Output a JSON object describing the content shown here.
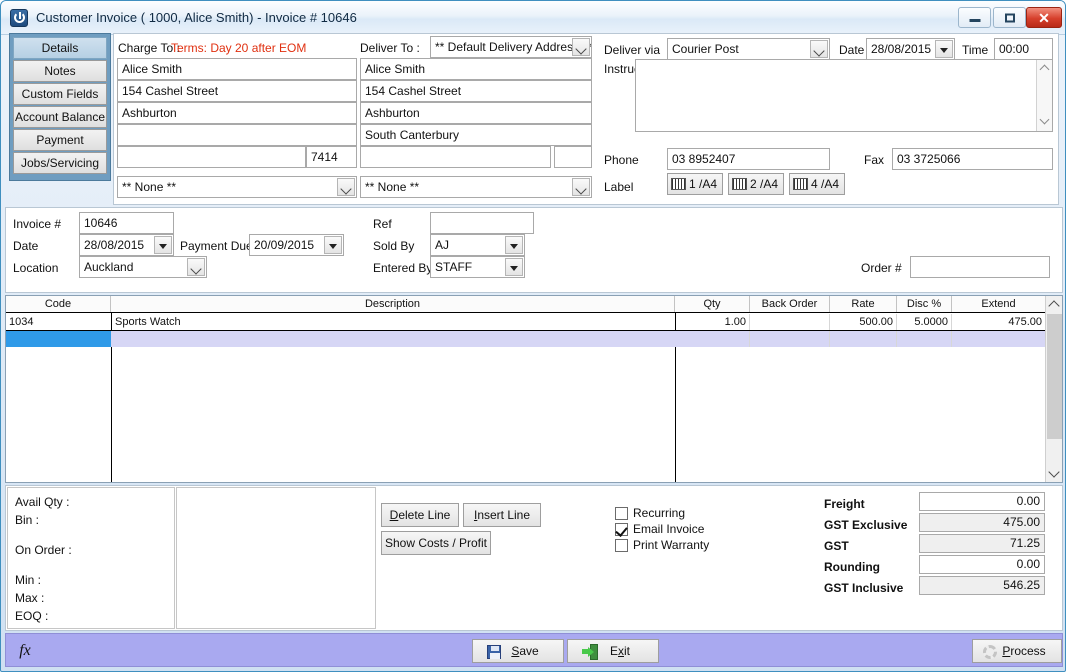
{
  "window": {
    "title": "Customer Invoice ( 1000, Alice Smith) - Invoice # 10646",
    "app_icon": "power-icon",
    "minimize_label": "",
    "maximize_label": "",
    "close_label": "✕"
  },
  "tabs": [
    {
      "label": "Details",
      "active": true
    },
    {
      "label": "Notes",
      "active": false
    },
    {
      "label": "Custom Fields",
      "active": false
    },
    {
      "label": "Account Balance",
      "active": false
    },
    {
      "label": "Payment",
      "active": false
    },
    {
      "label": "Jobs/Servicing",
      "active": false
    }
  ],
  "charge_to": {
    "label": "Charge To :",
    "terms": "Terms: Day 20 after EOM",
    "terms_color": "#e03010",
    "line1": "Alice Smith",
    "line2": "154 Cashel Street",
    "line3": "Ashburton",
    "line4": "",
    "line5": "",
    "postcode": "7414",
    "contact": "** None **"
  },
  "deliver_to": {
    "label": "Deliver To :",
    "address_select": "** Default Delivery Address **",
    "line1": "Alice Smith",
    "line2": "154 Cashel Street",
    "line3": "Ashburton",
    "line4": "South Canterbury",
    "line5": "",
    "postcode": "",
    "contact": "** None **"
  },
  "delivery": {
    "deliver_via_label": "Deliver via",
    "deliver_via": "Courier Post",
    "date_label": "Date",
    "date": "28/08/2015",
    "time_label": "Time",
    "time": "00:00",
    "instructions_label": "Instructions",
    "instructions": "",
    "phone_label": "Phone",
    "phone": "03 8952407",
    "fax_label": "Fax",
    "fax": "03 3725066",
    "label_label": "Label",
    "label_buttons": [
      "1 /A4",
      "2 /A4",
      "4 /A4"
    ]
  },
  "invoice": {
    "invoice_no_label": "Invoice #",
    "invoice_no": "10646",
    "date_label": "Date",
    "date": "28/08/2015",
    "payment_due_label": "Payment Due",
    "payment_due": "20/09/2015",
    "location_label": "Location",
    "location": "Auckland",
    "ref_label": "Ref",
    "ref": "",
    "sold_by_label": "Sold By",
    "sold_by": "AJ",
    "entered_by_label": "Entered By",
    "entered_by": "STAFF",
    "order_no_label": "Order #",
    "order_no": ""
  },
  "grid": {
    "columns": [
      "Code",
      "Description",
      "Qty",
      "Back Order",
      "Rate",
      "Disc %",
      "Extend"
    ],
    "rows": [
      {
        "code": "1034",
        "description": "Sports Watch",
        "qty": "1.00",
        "back_order": "",
        "rate": "500.00",
        "disc": "5.0000",
        "extend": "475.00"
      },
      {
        "code": "",
        "description": "",
        "qty": "",
        "back_order": "",
        "rate": "",
        "disc": "",
        "extend": "",
        "selected": true
      }
    ]
  },
  "stock_info": {
    "avail_qty_label": "Avail Qty :",
    "bin_label": "Bin :",
    "on_order_label": "On Order :",
    "min_label": "Min :",
    "max_label": "Max :",
    "eoq_label": "EOQ :"
  },
  "line_actions": {
    "delete_line": "Delete Line",
    "delete_line_accel": "D",
    "insert_line": "Insert Line",
    "insert_line_accel": "I",
    "show_costs": "Show Costs / Profit"
  },
  "options": [
    {
      "label": "Recurring",
      "checked": false
    },
    {
      "label": "Email Invoice",
      "checked": true
    },
    {
      "label": "Print Warranty",
      "checked": false
    }
  ],
  "totals": [
    {
      "label": "Freight",
      "value": "0.00",
      "readonly": false
    },
    {
      "label": "GST Exclusive",
      "value": "475.00",
      "readonly": true
    },
    {
      "label": "GST",
      "value": "71.25",
      "readonly": true
    },
    {
      "label": "Rounding",
      "value": "0.00",
      "readonly": false
    },
    {
      "label": "GST Inclusive",
      "value": "546.25",
      "readonly": true
    }
  ],
  "footer": {
    "fx_label": "fx",
    "save_label": "Save",
    "save_accel": "S",
    "exit_label": "Exit",
    "exit_accel": "x",
    "process_label": "Process",
    "process_accel": "P"
  }
}
